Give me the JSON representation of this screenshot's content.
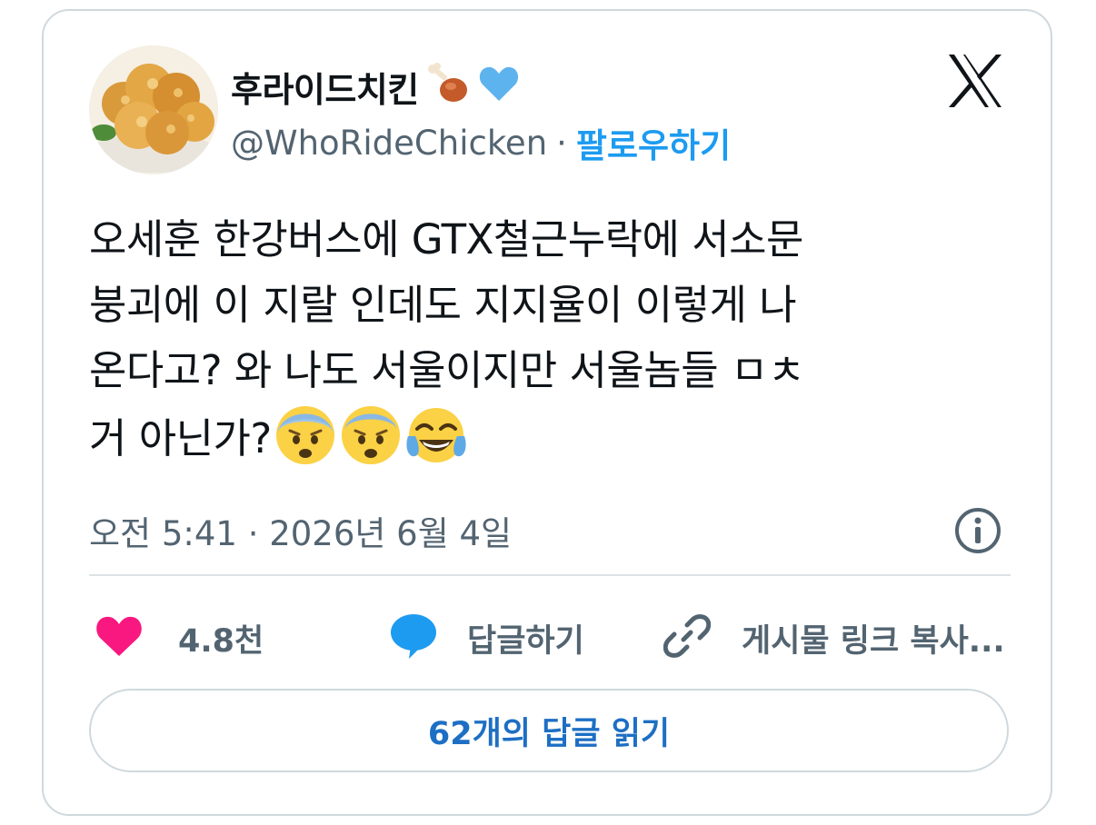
{
  "author": {
    "name": "후라이드치킨",
    "name_emojis": [
      "poultry-leg-emoji",
      "blue-heart-emoji"
    ],
    "handle": "@WhoRideChicken",
    "separator": "·",
    "follow_label": "팔로우하기"
  },
  "tweet": {
    "lines": [
      "오세훈 한강버스에 GTX철근누락에 서소문",
      "붕괴에 이 지랄 인데도 지지율이 이렇게 나",
      "온다고?  와 나도 서울이지만 서울놈들 ㅁㅊ",
      "거 아닌가?"
    ],
    "trailing_emojis": [
      "anxious-face-emoji",
      "anxious-face-emoji",
      "tears-of-joy-emoji"
    ],
    "timestamp": "오전 5:41 · 2026년 6월 4일"
  },
  "actions": {
    "like_count": "4.8천",
    "reply_label": "답글하기",
    "copy_link_label": "게시물 링크 복사..."
  },
  "read_replies_label": "62개의 답글 읽기",
  "colors": {
    "like": "#f91880",
    "reply": "#1d9bf0",
    "follow": "#1d9bf0",
    "muted": "#536471"
  }
}
